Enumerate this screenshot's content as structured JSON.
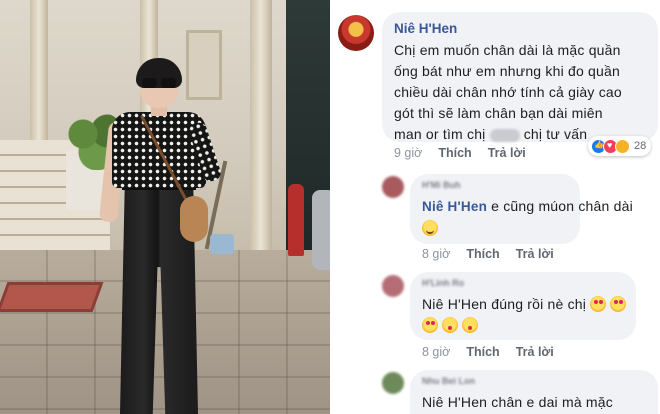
{
  "comments": [
    {
      "author": "Niê H'Hen",
      "lines": [
        "Chị em muốn chân dài là mặc quần",
        "ống bát như em nhưng khi đo quần",
        "chiều dài chân nhớ tính cả giày cao",
        "gót thì sẽ làm chân bạn dài miên"
      ],
      "line5_before": "man or tìm chị",
      "line5_after": "chị tư vấn",
      "time": "9 giờ",
      "like": "Thích",
      "reply": "Trả lời",
      "reaction_count": "28"
    },
    {
      "author_blur": "H'Mi Buh",
      "mention": "Niê H'Hen",
      "text1": " e cũng múon chân dài",
      "time": "8 giờ",
      "like": "Thích",
      "reply": "Trả lời"
    },
    {
      "author_blur": "H'Linh Ro",
      "mention": "Niê H'Hen",
      "text1": " đúng rồi nè chị",
      "time": "8 giờ",
      "like": "Thích",
      "reply": "Trả lời"
    },
    {
      "author_blur": "Nhu Bei Lon",
      "mention": "Niê H'Hen",
      "text1": " chân e dai mà mặc"
    }
  ],
  "colors": {
    "author": "#385898",
    "bubble": "#f1f2f6",
    "meta": "#8d949e"
  }
}
